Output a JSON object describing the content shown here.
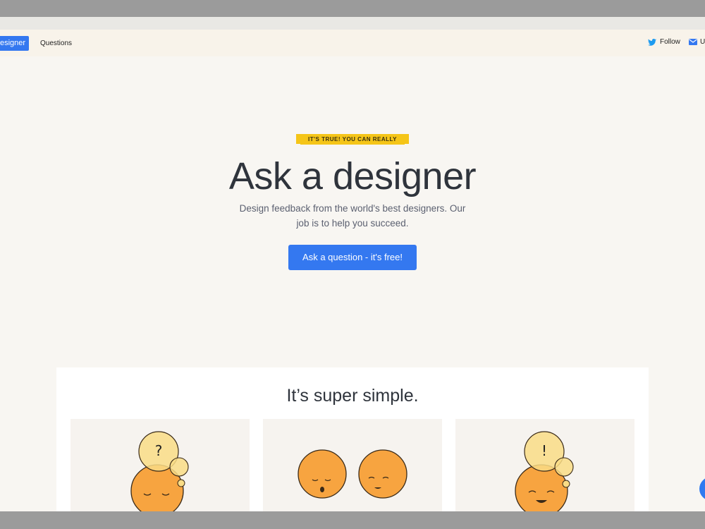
{
  "nav": {
    "brand_label": "esigner",
    "questions_label": "Questions",
    "follow_label": "Follow",
    "mail_label": "U"
  },
  "hero": {
    "ribbon": "IT'S TRUE! YOU CAN REALLY",
    "title": "Ask a designer",
    "subtitle": "Design feedback from the world's best designers. Our job is to help you succeed.",
    "cta_label": "Ask a question - it's free!"
  },
  "section": {
    "title": "It’s super simple."
  },
  "icons": {
    "twitter": "twitter-bird",
    "mail": "envelope",
    "card1": "thinking-question-face",
    "card2": "two-faces-talking",
    "card3": "idea-exclamation-face"
  },
  "colors": {
    "accent": "#3478f0",
    "ribbon": "#f5c518",
    "face": "#f7a440",
    "background": "#f8f6f2"
  }
}
